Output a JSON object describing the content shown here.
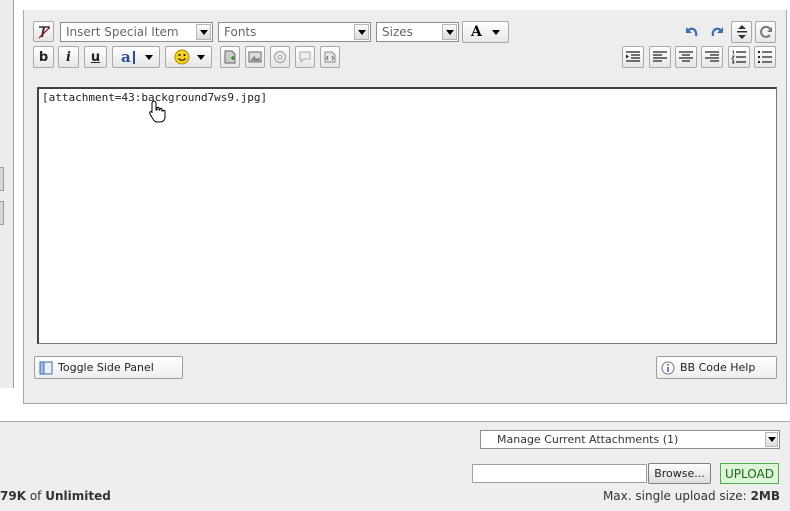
{
  "toolbar": {
    "special_item": "Insert Special Item",
    "fonts": "Fonts",
    "sizes": "Sizes",
    "font_color_letter": "A",
    "bold": "b",
    "italic": "i",
    "underline": "u",
    "text_color_letter": "a"
  },
  "editor": {
    "content": "[attachment=43:background7ws9.jpg]"
  },
  "buttons": {
    "toggle_side_panel": "Toggle Side Panel",
    "bb_code_help": "BB Code Help"
  },
  "attachments": {
    "manage_label": "Manage Current Attachments (1)",
    "browse_label": "Browse...",
    "upload_label": "UPLOAD",
    "quota_used": "79K",
    "quota_of": "of",
    "quota_total": "Unlimited",
    "max_size_label": "Max. single upload size:",
    "max_size_value": "2MB"
  },
  "colors": {
    "panel_bg": "#ededed",
    "upload_bg": "#dcf5d8",
    "upload_border": "#4fae4a",
    "undo_redo": "#3a6fb0"
  },
  "icons": {
    "remove_format": "remove-format-icon",
    "emoticon": "smiley-icon",
    "undo": "undo-icon",
    "redo": "redo-icon"
  }
}
